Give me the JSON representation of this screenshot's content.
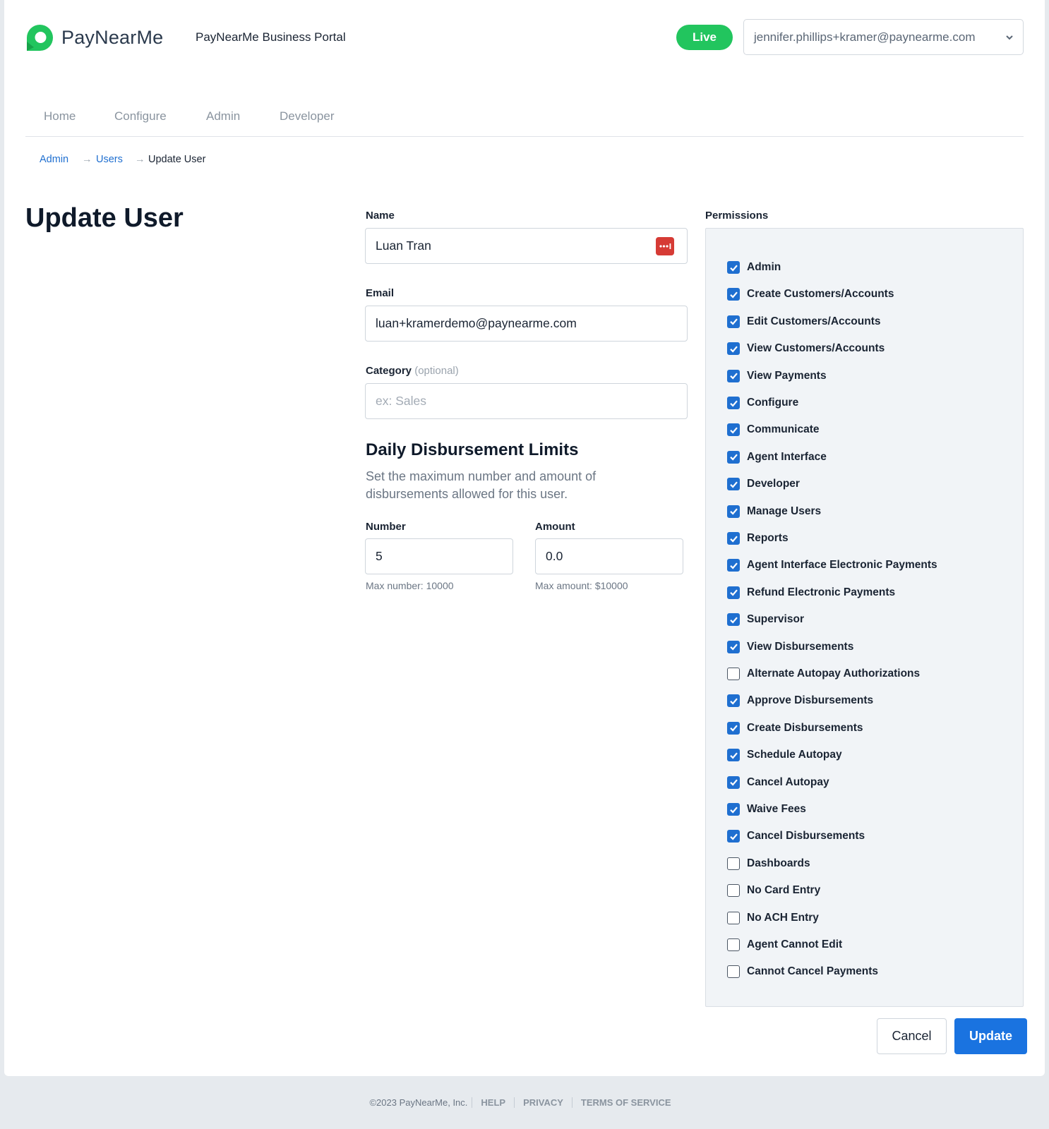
{
  "header": {
    "brand": "PayNearMe",
    "portal_title": "PayNearMe Business Portal",
    "env_badge": "Live",
    "user_email": "jennifer.phillips+kramer@paynearme.com"
  },
  "nav": {
    "items": [
      "Home",
      "Configure",
      "Admin",
      "Developer"
    ]
  },
  "breadcrumb": {
    "items": [
      "Admin",
      "Users",
      "Update User"
    ],
    "separator": "→"
  },
  "page": {
    "title": "Update User"
  },
  "form": {
    "name_label": "Name",
    "name_value": "Luan Tran",
    "email_label": "Email",
    "email_value": "luan+kramerdemo@paynearme.com",
    "category_label": "Category",
    "category_optional": "(optional)",
    "category_placeholder": "ex: Sales",
    "limits_title": "Daily Disbursement Limits",
    "limits_desc": "Set the maximum number and amount of disbursements allowed for this user.",
    "number_label": "Number",
    "number_value": "5",
    "number_hint": "Max number: 10000",
    "amount_label": "Amount",
    "amount_value": "0.0",
    "amount_hint": "Max amount: $10000"
  },
  "permissions": {
    "label": "Permissions",
    "items": [
      {
        "label": "Admin",
        "checked": true
      },
      {
        "label": "Create Customers/Accounts",
        "checked": true
      },
      {
        "label": "Edit Customers/Accounts",
        "checked": true
      },
      {
        "label": "View Customers/Accounts",
        "checked": true
      },
      {
        "label": "View Payments",
        "checked": true
      },
      {
        "label": "Configure",
        "checked": true
      },
      {
        "label": "Communicate",
        "checked": true
      },
      {
        "label": "Agent Interface",
        "checked": true
      },
      {
        "label": "Developer",
        "checked": true
      },
      {
        "label": "Manage Users",
        "checked": true
      },
      {
        "label": "Reports",
        "checked": true
      },
      {
        "label": "Agent Interface Electronic Payments",
        "checked": true
      },
      {
        "label": "Refund Electronic Payments",
        "checked": true
      },
      {
        "label": "Supervisor",
        "checked": true
      },
      {
        "label": "View Disbursements",
        "checked": true
      },
      {
        "label": "Alternate Autopay Authorizations",
        "checked": false
      },
      {
        "label": "Approve Disbursements",
        "checked": true
      },
      {
        "label": "Create Disbursements",
        "checked": true
      },
      {
        "label": "Schedule Autopay",
        "checked": true
      },
      {
        "label": "Cancel Autopay",
        "checked": true
      },
      {
        "label": "Waive Fees",
        "checked": true
      },
      {
        "label": "Cancel Disbursements",
        "checked": true
      },
      {
        "label": "Dashboards",
        "checked": false
      },
      {
        "label": "No Card Entry",
        "checked": false
      },
      {
        "label": "No ACH Entry",
        "checked": false
      },
      {
        "label": "Agent Cannot Edit",
        "checked": false
      },
      {
        "label": "Cannot Cancel Payments",
        "checked": false
      }
    ]
  },
  "actions": {
    "cancel": "Cancel",
    "update": "Update"
  },
  "footer": {
    "copyright": "©2023 PayNearMe, Inc.",
    "links": [
      "HELP",
      "PRIVACY",
      "TERMS OF SERVICE"
    ]
  },
  "colors": {
    "brand_green": "#22c55e",
    "accent_blue": "#1a73e0",
    "link_blue": "#1f6fd0"
  }
}
